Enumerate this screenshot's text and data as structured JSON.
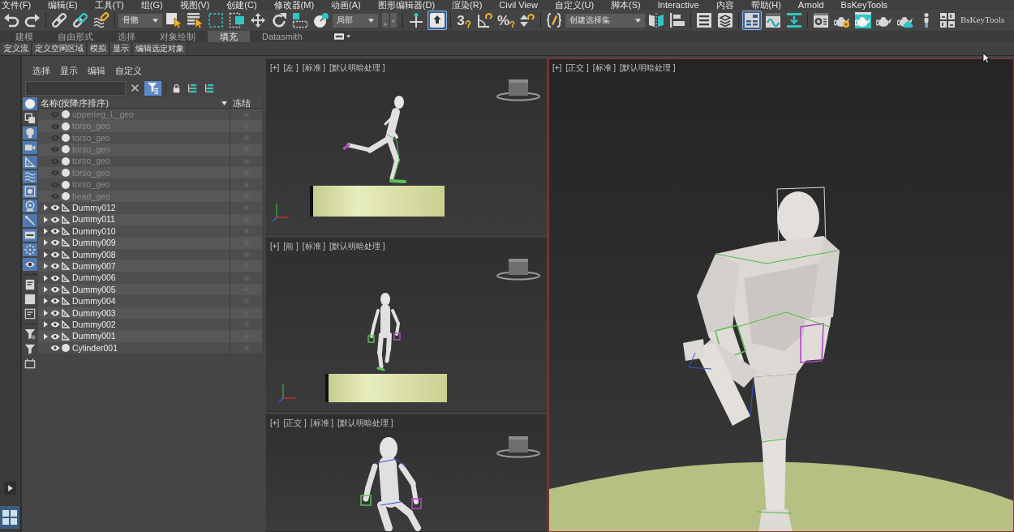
{
  "menu_bar": [
    "文件(F)",
    "编辑(E)",
    "工具(T)",
    "组(G)",
    "视图(V)",
    "创建(C)",
    "修改器(M)",
    "动画(A)",
    "图形编辑器(D)",
    "渲染(R)",
    "Civil View",
    "自定义(U)",
    "脚本(S)",
    "Interactive",
    "内容",
    "帮助(H)",
    "Arnold",
    "BsKeyTools"
  ],
  "toolbar": {
    "items": [
      {
        "kind": "button",
        "selected": false
      },
      {
        "kind": "button",
        "selected": false
      },
      {
        "kind": "separator"
      },
      {
        "kind": "button",
        "selected": false
      },
      {
        "kind": "button",
        "selected": false
      },
      {
        "kind": "button",
        "selected": false
      },
      {
        "kind": "separator"
      },
      {
        "kind": "dropdown",
        "value": "骨骼"
      },
      {
        "kind": "button",
        "selected": false
      },
      {
        "kind": "button",
        "selected": false
      },
      {
        "kind": "button",
        "selected": false
      },
      {
        "kind": "button",
        "selected": false
      },
      {
        "kind": "button",
        "selected": false
      },
      {
        "kind": "button",
        "selected": false
      },
      {
        "kind": "button",
        "selected": false
      },
      {
        "kind": "button",
        "selected": false
      },
      {
        "kind": "dropdown",
        "value": "局部"
      },
      {
        "kind": "button",
        "selected": false
      },
      {
        "kind": "separator"
      },
      {
        "kind": "button",
        "selected": false
      },
      {
        "kind": "button",
        "selected": true
      },
      {
        "kind": "separator"
      },
      {
        "kind": "button",
        "selected": false,
        "text": "3"
      },
      {
        "kind": "button",
        "selected": false
      },
      {
        "kind": "button",
        "selected": false,
        "text": "%"
      },
      {
        "kind": "button",
        "selected": false
      },
      {
        "kind": "separator"
      },
      {
        "kind": "button",
        "selected": false
      },
      {
        "kind": "dropdown",
        "value": "创建选择集"
      },
      {
        "kind": "button",
        "selected": false
      },
      {
        "kind": "button",
        "selected": false
      },
      {
        "kind": "separator"
      },
      {
        "kind": "button",
        "selected": false
      },
      {
        "kind": "button",
        "selected": false
      },
      {
        "kind": "separator"
      },
      {
        "kind": "button",
        "selected": true
      },
      {
        "kind": "button",
        "selected": false
      },
      {
        "kind": "button",
        "selected": false
      },
      {
        "kind": "separator"
      },
      {
        "kind": "button",
        "selected": false
      },
      {
        "kind": "button",
        "selected": false
      },
      {
        "kind": "button",
        "selected": false
      },
      {
        "kind": "button",
        "selected": false
      },
      {
        "kind": "button",
        "selected": false
      },
      {
        "kind": "button",
        "selected": false
      },
      {
        "kind": "button",
        "selected": false
      },
      {
        "kind": "label",
        "text": "BsKeyTools"
      }
    ]
  },
  "ribbon_tabs": [
    {
      "label": "建模",
      "selected": false
    },
    {
      "label": "自由形式",
      "selected": false
    },
    {
      "label": "选择",
      "selected": false
    },
    {
      "label": "对象绘制",
      "selected": false
    },
    {
      "label": "填充",
      "selected": true
    },
    {
      "label": "Datasmith",
      "selected": false
    }
  ],
  "ribbon_buttons": [
    "定义流",
    "定义空闲区域",
    "模拟",
    "显示",
    "编辑选定对象"
  ],
  "explorer": {
    "menu": [
      "选择",
      "显示",
      "编辑",
      "自定义"
    ],
    "filter_button": {
      "selected": true
    },
    "type_filters": [
      {
        "selected": true
      },
      {
        "selected": false
      },
      {
        "selected": true
      },
      {
        "selected": true
      },
      {
        "selected": true
      },
      {
        "selected": true
      },
      {
        "selected": true
      },
      {
        "selected": true
      },
      {
        "selected": true
      },
      {
        "selected": true
      },
      {
        "selected": true
      },
      {
        "selected": true
      },
      {
        "selected": false
      },
      {
        "selected": false
      },
      {
        "selected": false
      },
      {
        "selected": false
      },
      {
        "selected": false
      },
      {
        "selected": false
      }
    ],
    "columns": [
      {
        "label": "名称(按降序排序)",
        "sorted": true
      },
      {
        "label": "冻结",
        "sorted": false
      }
    ],
    "rows": [
      {
        "name": "upperleg_L_geo",
        "kind": "geometry",
        "hidden": true,
        "has_children": false,
        "frozen": false
      },
      {
        "name": "torso_geo",
        "kind": "geometry",
        "hidden": true,
        "has_children": false,
        "frozen": false
      },
      {
        "name": "torso_geo",
        "kind": "geometry",
        "hidden": true,
        "has_children": false,
        "frozen": false
      },
      {
        "name": "torso_geo",
        "kind": "geometry",
        "hidden": true,
        "has_children": false,
        "frozen": false
      },
      {
        "name": "torso_geo",
        "kind": "geometry",
        "hidden": true,
        "has_children": false,
        "frozen": false
      },
      {
        "name": "torso_geo",
        "kind": "geometry",
        "hidden": true,
        "has_children": false,
        "frozen": false
      },
      {
        "name": "torso_geo",
        "kind": "geometry",
        "hidden": true,
        "has_children": false,
        "frozen": false
      },
      {
        "name": "head_geo",
        "kind": "geometry",
        "hidden": true,
        "has_children": false,
        "frozen": false
      },
      {
        "name": "Dummy012",
        "kind": "helper",
        "hidden": false,
        "has_children": true,
        "frozen": false
      },
      {
        "name": "Dummy011",
        "kind": "helper",
        "hidden": false,
        "has_children": true,
        "frozen": false
      },
      {
        "name": "Dummy010",
        "kind": "helper",
        "hidden": false,
        "has_children": true,
        "frozen": false
      },
      {
        "name": "Dummy009",
        "kind": "helper",
        "hidden": false,
        "has_children": true,
        "frozen": false
      },
      {
        "name": "Dummy008",
        "kind": "helper",
        "hidden": false,
        "has_children": true,
        "frozen": false
      },
      {
        "name": "Dummy007",
        "kind": "helper",
        "hidden": false,
        "has_children": true,
        "frozen": false
      },
      {
        "name": "Dummy006",
        "kind": "helper",
        "hidden": false,
        "has_children": true,
        "frozen": false
      },
      {
        "name": "Dummy005",
        "kind": "helper",
        "hidden": false,
        "has_children": true,
        "frozen": false
      },
      {
        "name": "Dummy004",
        "kind": "helper",
        "hidden": false,
        "has_children": true,
        "frozen": false
      },
      {
        "name": "Dummy003",
        "kind": "helper",
        "hidden": false,
        "has_children": true,
        "frozen": false
      },
      {
        "name": "Dummy002",
        "kind": "helper",
        "hidden": false,
        "has_children": true,
        "frozen": false
      },
      {
        "name": "Dummy001",
        "kind": "helper",
        "hidden": false,
        "has_children": true,
        "frozen": false
      },
      {
        "name": "Cylinder001",
        "kind": "geometry",
        "hidden": false,
        "has_children": false,
        "frozen": false
      }
    ]
  },
  "viewports": [
    {
      "labels": [
        "[+]",
        "[左 ]",
        "[标准 ]",
        "[默认明暗处理 ]"
      ],
      "active": false
    },
    {
      "labels": [
        "[+]",
        "[前 ]",
        "[标准 ]",
        "[默认明暗处理 ]"
      ],
      "active": false
    },
    {
      "labels": [
        "[+]",
        "[正交 ]",
        "[标准 ]",
        "[默认明暗处理 ]"
      ],
      "active": false
    },
    {
      "labels": [
        "[+]",
        "[正交 ]",
        "[标准 ]",
        "[默认明暗处理 ]"
      ],
      "active": true
    }
  ]
}
